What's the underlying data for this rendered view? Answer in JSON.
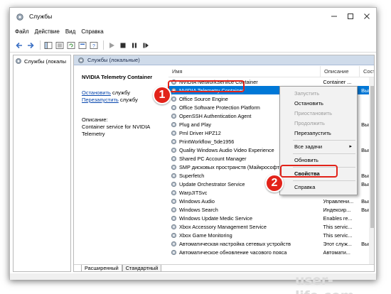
{
  "window": {
    "title": "Службы"
  },
  "menu": [
    "Файл",
    "Действие",
    "Вид",
    "Справка"
  ],
  "tree": {
    "item_label": "Службы (локалы"
  },
  "pane": {
    "header": "Службы (локальные)"
  },
  "details": {
    "service_title": "NVIDIA Telemetry Container",
    "stop_link": "Остановить",
    "stop_suffix": " службу",
    "restart_link": "Перезапустить",
    "restart_suffix": " службу",
    "description_label": "Описание:",
    "description_text": "Container service for NVIDIA Telemetry"
  },
  "columns": {
    "name": "Имя",
    "description": "Описание",
    "status": "Сост"
  },
  "services": [
    {
      "name": "NVIDIA NetworkService Container",
      "description": "Container ...",
      "status": ""
    },
    {
      "name": "NVIDIA Telemetry Container",
      "description": "Container ...",
      "status": "Выпо"
    },
    {
      "name": "Office  Source Engine",
      "description": "",
      "status": ""
    },
    {
      "name": "Office Software Protection Platform",
      "description": "",
      "status": ""
    },
    {
      "name": "OpenSSH Authentication Agent",
      "description": "",
      "status": ""
    },
    {
      "name": "Plug and Play",
      "description": "",
      "status": "Выпо"
    },
    {
      "name": "Pml Driver HPZ12",
      "description": "",
      "status": ""
    },
    {
      "name": "PrintWorkflow_5de1956",
      "description": "",
      "status": ""
    },
    {
      "name": "Quality Windows Audio Video Experience",
      "description": "",
      "status": "Выпо"
    },
    {
      "name": "Shared PC Account Manager",
      "description": "",
      "status": ""
    },
    {
      "name": "SMP дисковых пространств (Майкрософт)",
      "description": "",
      "status": ""
    },
    {
      "name": "Superfetch",
      "description": "",
      "status": "Выпо"
    },
    {
      "name": "Update Orchestrator Service",
      "description": "",
      "status": "Выпо"
    },
    {
      "name": "WarpJITSvc",
      "description": "",
      "status": ""
    },
    {
      "name": "Windows Audio",
      "description": "Управлени...",
      "status": "Выпо"
    },
    {
      "name": "Windows Search",
      "description": "Индексир...",
      "status": "Выпо"
    },
    {
      "name": "Windows Update Medic Service",
      "description": "Enables re...",
      "status": ""
    },
    {
      "name": "Xbox Accessory Management Service",
      "description": "This servic...",
      "status": ""
    },
    {
      "name": "Xbox Game Monitoring",
      "description": "This servic...",
      "status": ""
    },
    {
      "name": "Автоматическая настройка сетевых устройств",
      "description": "Этот служ...",
      "status": "Выпо"
    },
    {
      "name": "Автоматическое обновление часового пояса",
      "description": "Автомати...",
      "status": ""
    }
  ],
  "selected_index": 1,
  "context_menu": {
    "start": "Запустить",
    "stop": "Остановить",
    "pause": "Приостановить",
    "resume": "Продолжить",
    "restart": "Перезапустить",
    "all_tasks": "Все задачи",
    "refresh": "Обновить",
    "properties": "Свойства",
    "help": "Справка"
  },
  "tabs": {
    "extended": "Расширенный",
    "standard": "Стандартный"
  },
  "annotations": {
    "step1": "1",
    "step2": "2",
    "accent_color": "#e2231a"
  },
  "watermark": "user-life.com"
}
